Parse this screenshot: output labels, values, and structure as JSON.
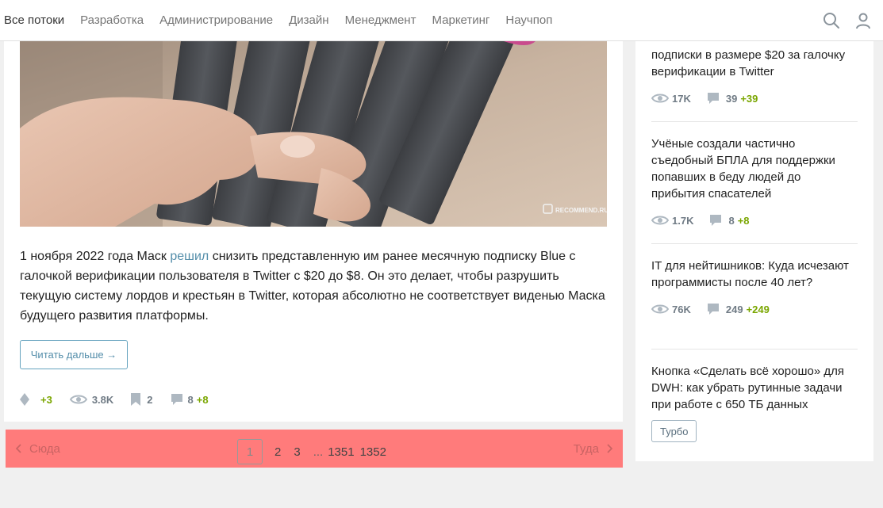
{
  "nav": {
    "flows": [
      "Все потоки",
      "Разработка",
      "Администрирование",
      "Дизайн",
      "Менеджмент",
      "Маркетинг",
      "Научпоп"
    ]
  },
  "article": {
    "image_watermark": "RECOMMEND.RU",
    "text_before_link": "1 ноября 2022 года Маск ",
    "link_text": "решил",
    "text_after_link": " снизить представленную им ранее месячную подписку Blue с галочкой верификации пользователя в Twitter с $20 до $8. Он это делает, чтобы разрушить текущую систему лордов и крестьян в Twitter, которая абсолютно не соответствует виденью Маска будущего развития платформы.",
    "read_more": "Читать дальше →",
    "stats": {
      "votes": "+3",
      "views": "3.8K",
      "bookmarks": "2",
      "comments": "8",
      "comments_new": "+8"
    }
  },
  "pagination": {
    "prev": "Сюда",
    "next": "Туда",
    "current": "1",
    "pages": [
      "2",
      "3"
    ],
    "dots": "...",
    "last_pages": [
      "1351",
      "1352"
    ]
  },
  "sidebar": {
    "items": [
      {
        "title": "подписки в размере $20 за галочку верификации в Twitter",
        "views": "17K",
        "comments": "39",
        "comments_new": "+39"
      },
      {
        "title": "Учёные создали частично съедобный БПЛА для поддержки попавших в беду людей до прибытия спасателей",
        "views": "1.7K",
        "comments": "8",
        "comments_new": "+8"
      },
      {
        "title": "IT для нейтишников: Куда исчезают программисты после 40 лет?",
        "views": "76K",
        "comments": "249",
        "comments_new": "+249"
      },
      {
        "title": "Кнопка «Сделать всё хорошо» для DWH: как убрать рутинные задачи при работе с 650 ТБ данных",
        "tag": "Турбо"
      }
    ]
  },
  "colors": {
    "link": "#548eaa",
    "pagination_bg": "#ff7b7b",
    "positive": "#7aa600",
    "meta": "#707b85"
  }
}
